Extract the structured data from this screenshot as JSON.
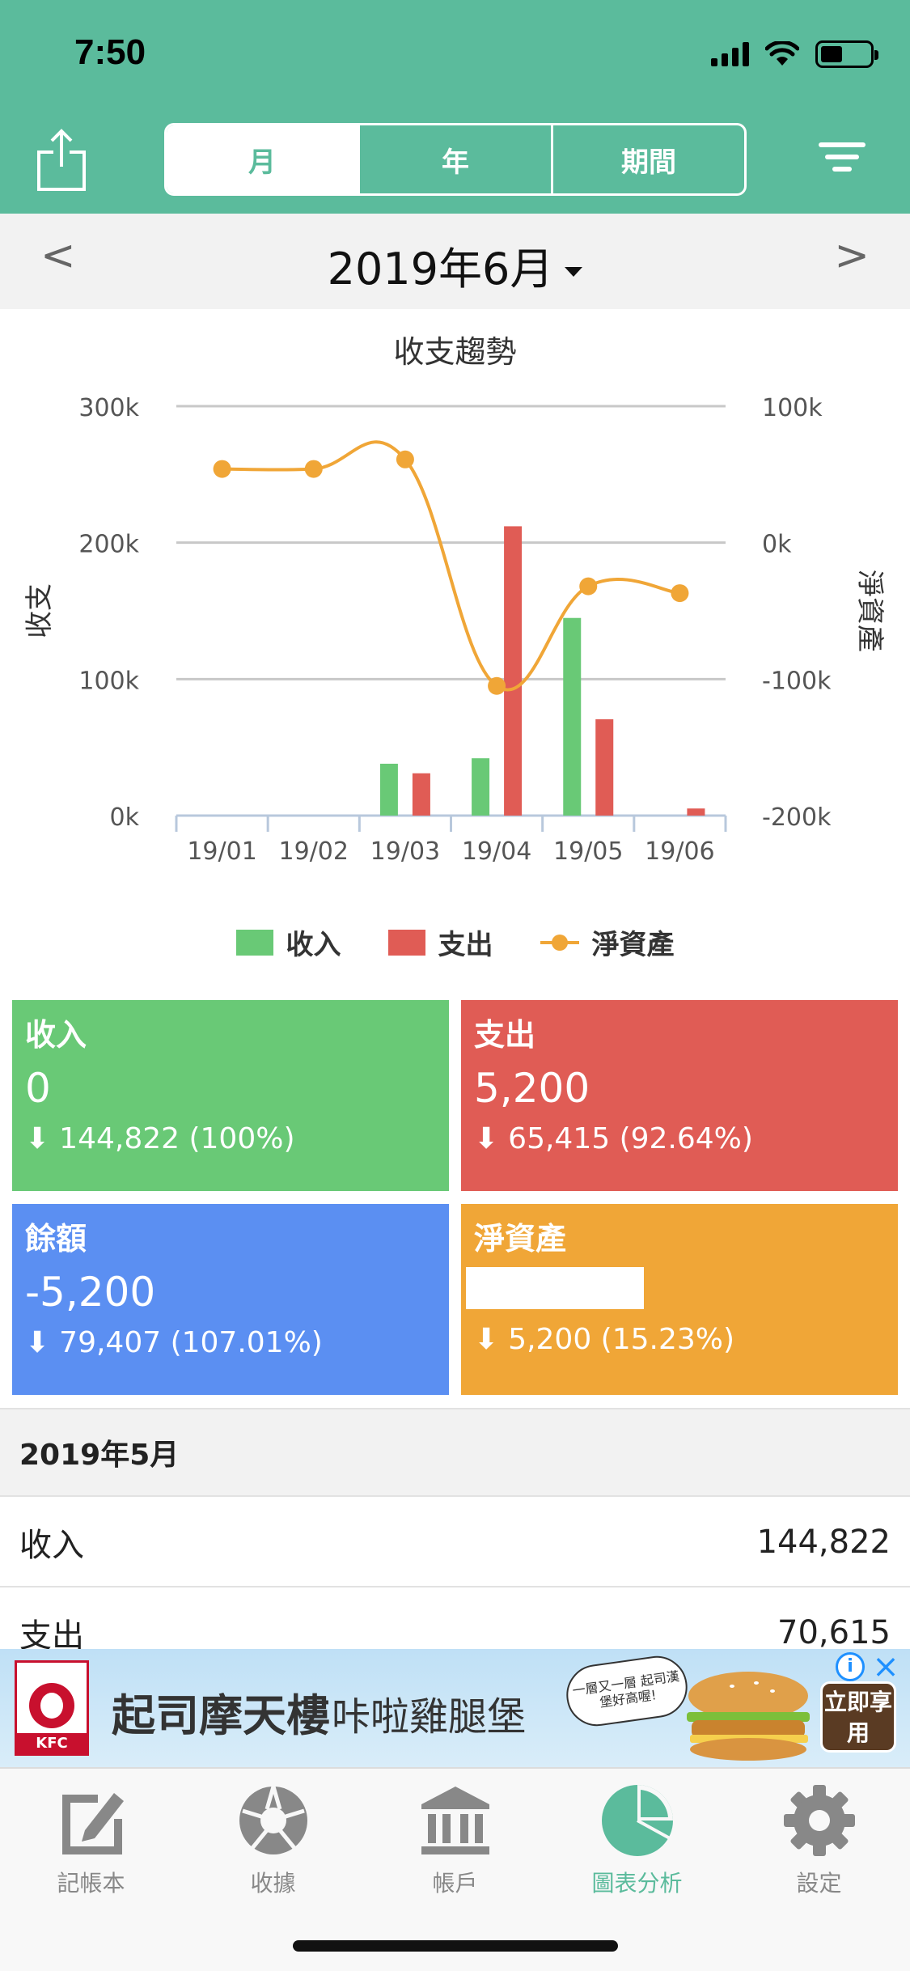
{
  "status_bar": {
    "time": "7:50"
  },
  "header": {
    "segments": [
      "月",
      "年",
      "期間"
    ],
    "active_segment": "月"
  },
  "month_nav": {
    "prev": "<",
    "next": ">",
    "title": "2019年6月"
  },
  "chart_data": {
    "type": "bar",
    "title": "收支趨勢",
    "categories": [
      "19/01",
      "19/02",
      "19/03",
      "19/04",
      "19/05",
      "19/06"
    ],
    "ylabel_left": "收支",
    "ylabel_right": "淨資產",
    "left_ticks": [
      "300k",
      "200k",
      "100k",
      "0k"
    ],
    "right_ticks": [
      "100k",
      "0k",
      "-100k",
      "-200k"
    ],
    "ylim_left": [
      0,
      300000
    ],
    "ylim_right": [
      -200000,
      100000
    ],
    "series": [
      {
        "name": "收入",
        "type": "bar",
        "color": "#69c976",
        "values": [
          0,
          0,
          38000,
          42000,
          144822,
          0
        ]
      },
      {
        "name": "支出",
        "type": "bar",
        "color": "#e05c55",
        "values": [
          0,
          0,
          31000,
          212000,
          70615,
          5200
        ]
      },
      {
        "name": "淨資產",
        "type": "line",
        "color": "#f0a637",
        "values": [
          54000,
          54000,
          61000,
          -105000,
          -32000,
          -37000
        ]
      }
    ],
    "grid": true,
    "legend_position": "bottom"
  },
  "cards": {
    "income": {
      "title": "收入",
      "value": "0",
      "change": "144,822 (100%)"
    },
    "expense": {
      "title": "支出",
      "value": "5,200",
      "change": "65,415 (92.64%)"
    },
    "balance": {
      "title": "餘額",
      "value": "-5,200",
      "change": "79,407 (107.01%)"
    },
    "networth": {
      "title": "淨資產",
      "change": "5,200 (15.23%)"
    }
  },
  "summary": {
    "header": "2019年5月",
    "rows": [
      {
        "label": "收入",
        "value": "144,822"
      },
      {
        "label": "支出",
        "value": "70,615"
      }
    ]
  },
  "ad": {
    "brand": "KFC",
    "headline": "起司摩天樓",
    "subline": "咔啦雞腿堡",
    "bubble": "一層又一層 起司漢堡好高喔!",
    "cta": "立即享用"
  },
  "tabbar": {
    "items": [
      {
        "label": "記帳本",
        "icon": "notebook-icon"
      },
      {
        "label": "收據",
        "icon": "aperture-icon"
      },
      {
        "label": "帳戶",
        "icon": "bank-icon"
      },
      {
        "label": "圖表分析",
        "icon": "pie-chart-icon"
      },
      {
        "label": "設定",
        "icon": "gear-icon"
      }
    ],
    "active": "圖表分析"
  }
}
